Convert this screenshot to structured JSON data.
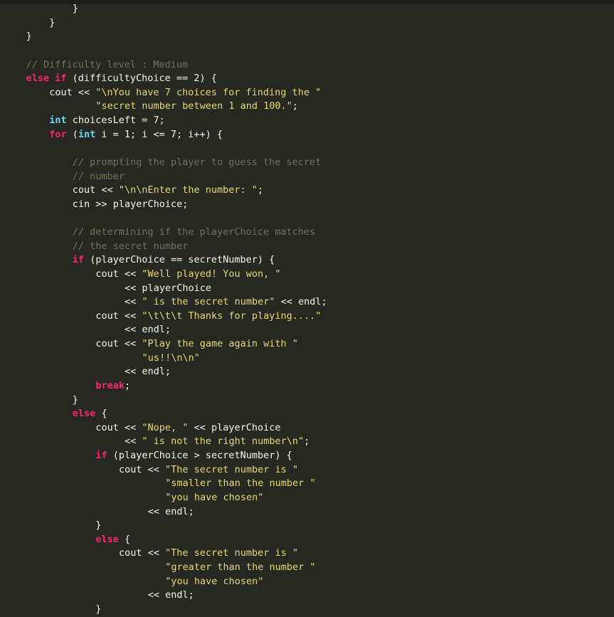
{
  "editor": {
    "lines": [
      {
        "indent": 12,
        "tokens": [
          {
            "t": "plain",
            "v": "}"
          }
        ]
      },
      {
        "indent": 8,
        "tokens": [
          {
            "t": "plain",
            "v": "}"
          }
        ]
      },
      {
        "indent": 4,
        "tokens": [
          {
            "t": "plain",
            "v": "}"
          }
        ]
      },
      {
        "indent": 0,
        "tokens": []
      },
      {
        "indent": 4,
        "tokens": [
          {
            "t": "cmt",
            "v": "// Difficulty level : Medium"
          }
        ]
      },
      {
        "indent": 4,
        "tokens": [
          {
            "t": "kw",
            "v": "else"
          },
          {
            "t": "plain",
            "v": " "
          },
          {
            "t": "kw",
            "v": "if"
          },
          {
            "t": "plain",
            "v": " (difficultyChoice == 2) {"
          }
        ]
      },
      {
        "indent": 8,
        "tokens": [
          {
            "t": "plain",
            "v": "cout << "
          },
          {
            "t": "str",
            "v": "\"\\nYou have 7 choices for finding the \""
          }
        ]
      },
      {
        "indent": 16,
        "tokens": [
          {
            "t": "str",
            "v": "\"secret number between 1 and 100.\""
          },
          {
            "t": "plain",
            "v": ";"
          }
        ]
      },
      {
        "indent": 8,
        "tokens": [
          {
            "t": "type",
            "v": "int"
          },
          {
            "t": "plain",
            "v": " choicesLeft = 7;"
          }
        ]
      },
      {
        "indent": 8,
        "tokens": [
          {
            "t": "kw",
            "v": "for"
          },
          {
            "t": "plain",
            "v": " ("
          },
          {
            "t": "type",
            "v": "int"
          },
          {
            "t": "plain",
            "v": " i = 1; i <= 7; i++) {"
          }
        ]
      },
      {
        "indent": 0,
        "tokens": []
      },
      {
        "indent": 12,
        "tokens": [
          {
            "t": "cmt",
            "v": "// prompting the player to guess the secret"
          }
        ]
      },
      {
        "indent": 12,
        "tokens": [
          {
            "t": "cmt",
            "v": "// number"
          }
        ]
      },
      {
        "indent": 12,
        "tokens": [
          {
            "t": "plain",
            "v": "cout << "
          },
          {
            "t": "str",
            "v": "\"\\n\\nEnter the number: \""
          },
          {
            "t": "plain",
            "v": ";"
          }
        ]
      },
      {
        "indent": 12,
        "tokens": [
          {
            "t": "plain",
            "v": "cin >> playerChoice;"
          }
        ]
      },
      {
        "indent": 0,
        "tokens": []
      },
      {
        "indent": 12,
        "tokens": [
          {
            "t": "cmt",
            "v": "// determining if the playerChoice matches"
          }
        ]
      },
      {
        "indent": 12,
        "tokens": [
          {
            "t": "cmt",
            "v": "// the secret number"
          }
        ]
      },
      {
        "indent": 12,
        "tokens": [
          {
            "t": "kw",
            "v": "if"
          },
          {
            "t": "plain",
            "v": " (playerChoice == secretNumber) {"
          }
        ]
      },
      {
        "indent": 16,
        "tokens": [
          {
            "t": "plain",
            "v": "cout << "
          },
          {
            "t": "str",
            "v": "\"Well played! You won, \""
          }
        ]
      },
      {
        "indent": 21,
        "tokens": [
          {
            "t": "plain",
            "v": "<< playerChoice"
          }
        ]
      },
      {
        "indent": 21,
        "tokens": [
          {
            "t": "plain",
            "v": "<< "
          },
          {
            "t": "str",
            "v": "\" is the secret number\""
          },
          {
            "t": "plain",
            "v": " << endl;"
          }
        ]
      },
      {
        "indent": 16,
        "tokens": [
          {
            "t": "plain",
            "v": "cout << "
          },
          {
            "t": "str",
            "v": "\"\\t\\t\\t Thanks for playing....\""
          }
        ]
      },
      {
        "indent": 21,
        "tokens": [
          {
            "t": "plain",
            "v": "<< endl;"
          }
        ]
      },
      {
        "indent": 16,
        "tokens": [
          {
            "t": "plain",
            "v": "cout << "
          },
          {
            "t": "str",
            "v": "\"Play the game again with \""
          }
        ]
      },
      {
        "indent": 24,
        "tokens": [
          {
            "t": "str",
            "v": "\"us!!\\n\\n\""
          }
        ]
      },
      {
        "indent": 21,
        "tokens": [
          {
            "t": "plain",
            "v": "<< endl;"
          }
        ]
      },
      {
        "indent": 16,
        "tokens": [
          {
            "t": "kw",
            "v": "break"
          },
          {
            "t": "plain",
            "v": ";"
          }
        ]
      },
      {
        "indent": 12,
        "tokens": [
          {
            "t": "plain",
            "v": "}"
          }
        ]
      },
      {
        "indent": 12,
        "tokens": [
          {
            "t": "kw",
            "v": "else"
          },
          {
            "t": "plain",
            "v": " {"
          }
        ]
      },
      {
        "indent": 16,
        "tokens": [
          {
            "t": "plain",
            "v": "cout << "
          },
          {
            "t": "str",
            "v": "\"Nope, \""
          },
          {
            "t": "plain",
            "v": " << playerChoice"
          }
        ]
      },
      {
        "indent": 21,
        "tokens": [
          {
            "t": "plain",
            "v": "<< "
          },
          {
            "t": "str",
            "v": "\" is not the right number\\n\""
          },
          {
            "t": "plain",
            "v": ";"
          }
        ]
      },
      {
        "indent": 16,
        "tokens": [
          {
            "t": "kw",
            "v": "if"
          },
          {
            "t": "plain",
            "v": " (playerChoice > secretNumber) {"
          }
        ]
      },
      {
        "indent": 20,
        "tokens": [
          {
            "t": "plain",
            "v": "cout << "
          },
          {
            "t": "str",
            "v": "\"The secret number is \""
          }
        ]
      },
      {
        "indent": 28,
        "tokens": [
          {
            "t": "str",
            "v": "\"smaller than the number \""
          }
        ]
      },
      {
        "indent": 28,
        "tokens": [
          {
            "t": "str",
            "v": "\"you have chosen\""
          }
        ]
      },
      {
        "indent": 25,
        "tokens": [
          {
            "t": "plain",
            "v": "<< endl;"
          }
        ]
      },
      {
        "indent": 16,
        "tokens": [
          {
            "t": "plain",
            "v": "}"
          }
        ]
      },
      {
        "indent": 16,
        "tokens": [
          {
            "t": "kw",
            "v": "else"
          },
          {
            "t": "plain",
            "v": " {"
          }
        ]
      },
      {
        "indent": 20,
        "tokens": [
          {
            "t": "plain",
            "v": "cout << "
          },
          {
            "t": "str",
            "v": "\"The secret number is \""
          }
        ]
      },
      {
        "indent": 28,
        "tokens": [
          {
            "t": "str",
            "v": "\"greater than the number \""
          }
        ]
      },
      {
        "indent": 28,
        "tokens": [
          {
            "t": "str",
            "v": "\"you have chosen\""
          }
        ]
      },
      {
        "indent": 25,
        "tokens": [
          {
            "t": "plain",
            "v": "<< endl;"
          }
        ]
      },
      {
        "indent": 16,
        "tokens": [
          {
            "t": "plain",
            "v": "}"
          }
        ]
      }
    ]
  },
  "colors": {
    "background": "#272822",
    "keyword": "#f92672",
    "type": "#66d9ef",
    "string": "#e6db74",
    "comment": "#75715e",
    "text": "#f8f8f2"
  }
}
